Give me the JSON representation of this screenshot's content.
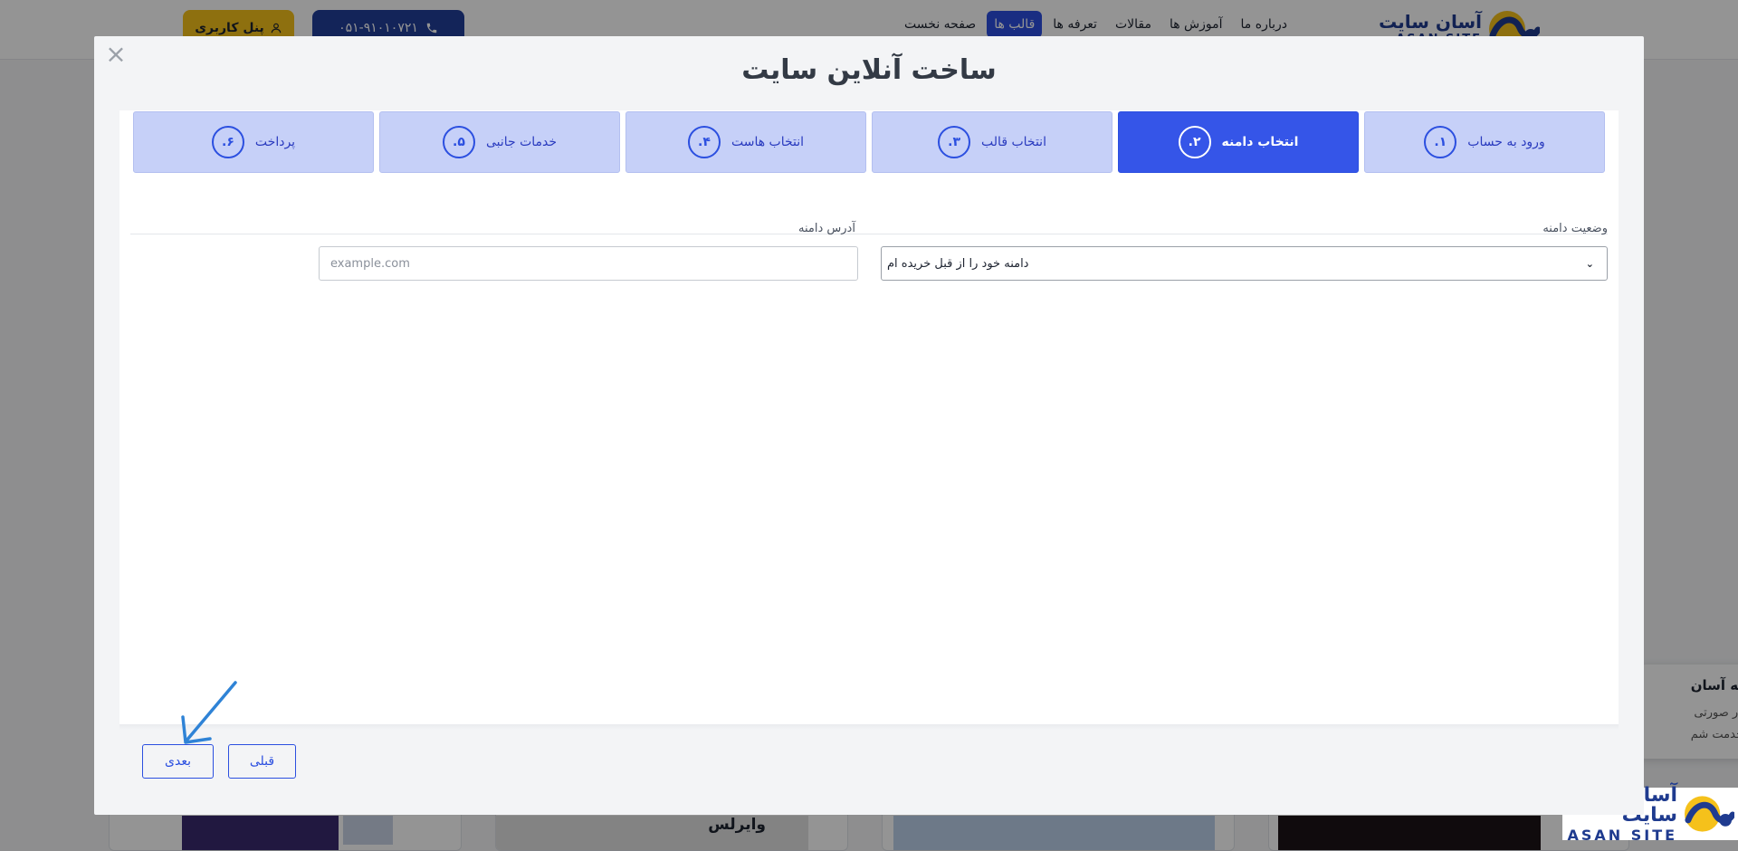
{
  "site": {
    "logo": {
      "name_fa": "آسان سایت",
      "name_en": "ASAN SITE"
    },
    "nav": [
      "صفحه نخست",
      "قالب ها",
      "تعرفه ها",
      "مقالات",
      "آموزش ها",
      "درباره ما"
    ],
    "nav_active_index": 1,
    "phone": "۰۵۱-۹۱۰۱۰۷۲۱",
    "panel_label": "پنل کاربری",
    "cards": [
      {
        "caption": ""
      },
      {
        "caption": "وایرلس"
      },
      {
        "caption": ""
      },
      {
        "caption": ""
      }
    ],
    "toast": {
      "title": "به آسان",
      "line1": "در صورتی",
      "line2": "خدمت شم"
    }
  },
  "modal": {
    "title": "ساخت آنلاین سایت",
    "close_symbol": "×",
    "steps": [
      {
        "num": "۱.",
        "label": "ورود به حساب"
      },
      {
        "num": "۲.",
        "label": "انتخاب دامنه"
      },
      {
        "num": "۳.",
        "label": "انتخاب قالب"
      },
      {
        "num": "۴.",
        "label": "انتخاب هاست"
      },
      {
        "num": "۵.",
        "label": "خدمات جانبی"
      },
      {
        "num": "۶.",
        "label": "پرداخت"
      }
    ],
    "active_step_index": 1,
    "domain_status": {
      "label": "وضعیت دامنه",
      "selected": "دامنه خود را از قبل خریده ام"
    },
    "domain_address": {
      "label": "آدرس دامنه",
      "value": "",
      "placeholder": "example.com"
    },
    "buttons": {
      "next": "بعدی",
      "prev": "قبلی"
    }
  },
  "colors": {
    "primary": "#2b4fe0",
    "step_inactive": "#c6d0f8",
    "brand_dark": "#213e9a",
    "accent_yellow": "#f5c11b",
    "annotation_arrow": "#2f83d6"
  }
}
